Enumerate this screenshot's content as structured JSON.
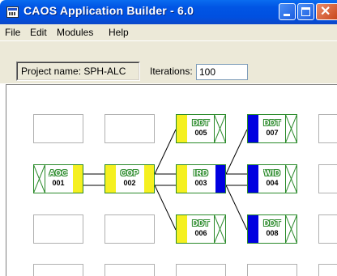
{
  "window": {
    "title": "CAOS Application Builder - 6.0"
  },
  "menu": [
    {
      "label": "File"
    },
    {
      "label": "Edit"
    },
    {
      "label": "Modules"
    },
    {
      "label": "Help"
    }
  ],
  "project": {
    "label": "Project name: SPH-ALC"
  },
  "iterations": {
    "label": "Iterations:",
    "value": "100"
  },
  "colors": {
    "module_border": "#2a8a2a",
    "port_yellow": "#f5f020",
    "port_blue": "#0000e0"
  },
  "modules": [
    {
      "name": "AOC",
      "num": "001",
      "in_port": "",
      "out_port": "yellow"
    },
    {
      "name": "COP",
      "num": "002",
      "in_port": "yellow",
      "out_port": "yellow"
    },
    {
      "name": "DDT",
      "num": "005",
      "in_port": "yellow",
      "out_port": ""
    },
    {
      "name": "IRD",
      "num": "003",
      "in_port": "yellow",
      "out_port": "blue"
    },
    {
      "name": "DDT",
      "num": "006",
      "in_port": "yellow",
      "out_port": ""
    },
    {
      "name": "DDT",
      "num": "007",
      "in_port": "blue",
      "out_port": ""
    },
    {
      "name": "WID",
      "num": "004",
      "in_port": "blue",
      "out_port": ""
    },
    {
      "name": "DDT",
      "num": "008",
      "in_port": "blue",
      "out_port": ""
    }
  ]
}
